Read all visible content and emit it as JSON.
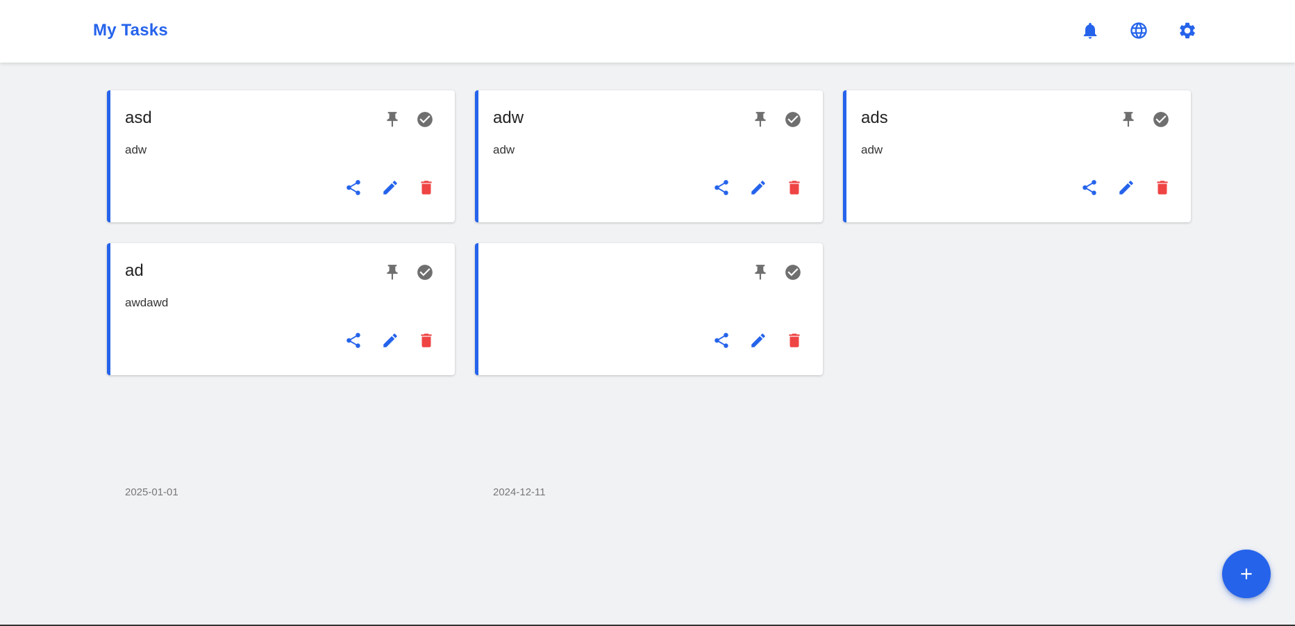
{
  "header": {
    "title": "My Tasks",
    "icons": [
      "bell-icon",
      "globe-icon",
      "gear-icon"
    ]
  },
  "tasks": [
    {
      "title": "asd",
      "description": "adw",
      "date": ""
    },
    {
      "title": "adw",
      "description": "adw",
      "date": ""
    },
    {
      "title": "ads",
      "description": "adw",
      "date": ""
    },
    {
      "title": "ad",
      "description": "awdawd",
      "date": "2025-01-01"
    },
    {
      "title": "",
      "description": "",
      "date": "2024-12-11"
    }
  ],
  "card_icons": {
    "pin": "pin-icon",
    "complete": "check-circle-icon",
    "share": "share-icon",
    "edit": "pencil-icon",
    "delete": "trash-icon"
  },
  "fab": {
    "icon": "plus-icon"
  },
  "colors": {
    "accent": "#2563eb",
    "danger": "#ef4444",
    "muted": "#6f6f6f",
    "background": "#f1f2f4"
  }
}
